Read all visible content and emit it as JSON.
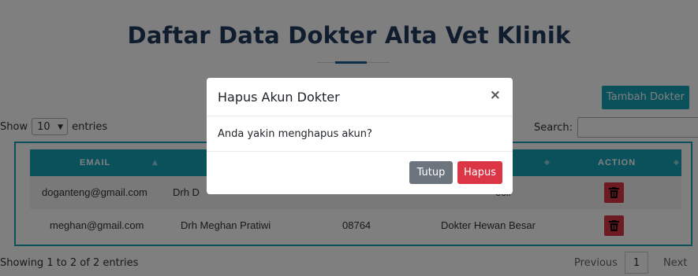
{
  "page": {
    "heading": "Daftar Data Dokter Alta Vet Klinik",
    "add_button": "Tambah Dokter"
  },
  "table_controls": {
    "show_label": "Show",
    "entries_value": "10",
    "entries_label": "entries",
    "search_label": "Search:",
    "search_value": ""
  },
  "table": {
    "headers": [
      "EMAIL",
      "",
      "",
      "R",
      "ACTION"
    ],
    "rows": [
      {
        "email": "doganteng@gmail.com",
        "name": "Drh D",
        "phone": "",
        "specialty": "ecil"
      },
      {
        "email": "meghan@gmail.com",
        "name": "Drh Meghan Pratiwi",
        "phone": "08764",
        "specialty": "Dokter Hewan Besar"
      }
    ]
  },
  "footer": {
    "info": "Showing 1 to 2 of 2 entries",
    "previous": "Previous",
    "page": "1",
    "next": "Next"
  },
  "modal": {
    "title": "Hapus Akun Dokter",
    "close_symbol": "×",
    "body": "Anda yakin menghapus akun?",
    "cancel_label": "Tutup",
    "confirm_label": "Hapus"
  },
  "colors": {
    "accent": "#17a2b8",
    "danger": "#dc3545",
    "secondary": "#6c757d",
    "heading": "#1f3a5f"
  },
  "icons": {
    "sort": "sort-icon",
    "delete": "trash-icon",
    "dropdown": "chevron-down-icon"
  }
}
